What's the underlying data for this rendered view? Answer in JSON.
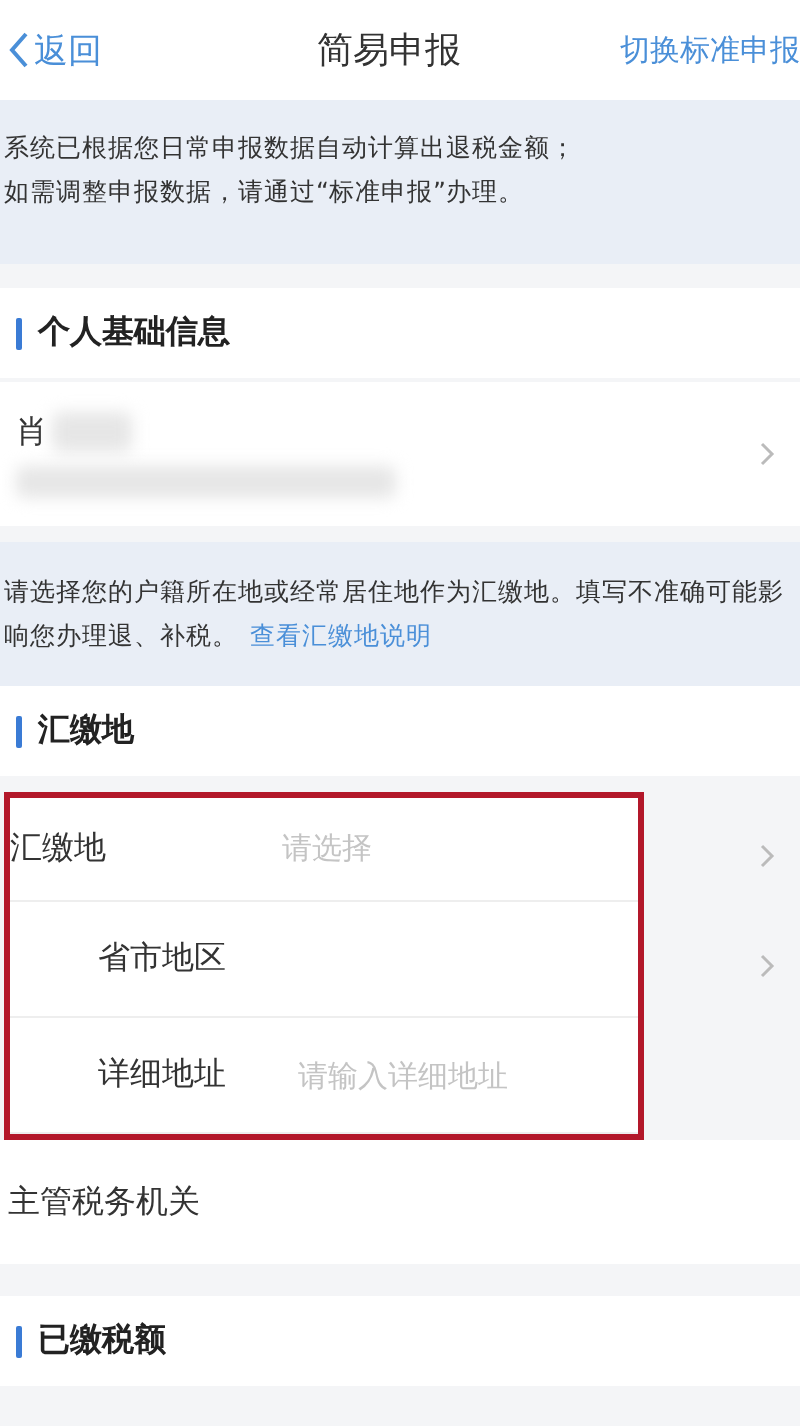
{
  "nav": {
    "back": "返回",
    "title": "简易申报",
    "action": "切换标准申报"
  },
  "notice": [
    "系统已根据您日常申报数据自动计算出退税金额；",
    "如需调整申报数据，请通过“标准申报”办理。"
  ],
  "sections": [
    {
      "title": "个人基础信息",
      "person": {
        "name": "肖",
        "redacted": true
      }
    },
    {
      "note": "请选择您的户籍所在地或经常居住地作为汇缴地。填写不准确可能影响您办理退、补税。",
      "note_link": "查看汇缴地说明",
      "title": "汇缴地",
      "highlighted": true,
      "rows": [
        {
          "kind": "select",
          "label": "汇缴地",
          "placeholder": "请选择",
          "children": [
            {
              "kind": "select",
              "label": "省市地区"
            },
            {
              "kind": "input",
              "label": "详细地址",
              "placeholder": "请输入详细地址"
            }
          ]
        }
      ],
      "after_rows": [
        {
          "kind": "plain",
          "label": "主管税务机关"
        }
      ]
    },
    {
      "title": "已缴税额"
    }
  ]
}
